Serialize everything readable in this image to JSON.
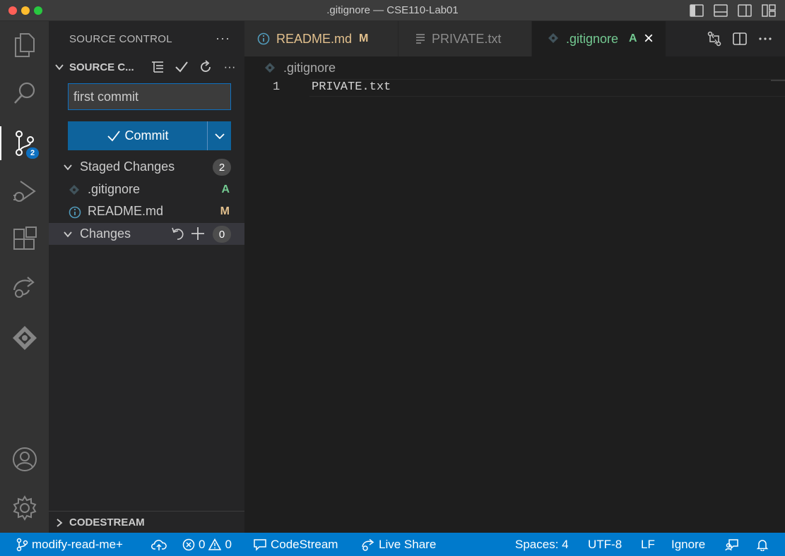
{
  "window": {
    "title": ".gitignore — CSE110-Lab01"
  },
  "activity_bar": {
    "items": [
      "explorer-icon",
      "search-icon",
      "source-control-icon",
      "run-debug-icon",
      "extensions-icon",
      "live-share-icon",
      "codestream-icon",
      "accounts-icon",
      "manage-gear-icon"
    ],
    "source_control_badge": "2"
  },
  "sidebar": {
    "header": "SOURCE CONTROL",
    "more": "···",
    "section_title": "SOURCE C...",
    "section_more": "···",
    "commit_message": "first commit",
    "commit_label": "Commit",
    "staged": {
      "label": "Staged Changes",
      "count": "2",
      "files": [
        {
          "name": ".gitignore",
          "status": "A",
          "status_color": "#73c991"
        },
        {
          "name": "README.md",
          "status": "M",
          "status_color": "#e2c08d"
        }
      ]
    },
    "changes": {
      "label": "Changes",
      "count": "0"
    },
    "codestream_section": "CODESTREAM"
  },
  "tabs": [
    {
      "label": "README.md",
      "status": "M",
      "color": "#e2c08d"
    },
    {
      "label": "PRIVATE.txt",
      "status": "",
      "color": "#8c8c8c"
    },
    {
      "label": ".gitignore",
      "status": "A",
      "color": "#73c991",
      "close": "×"
    }
  ],
  "editor_actions": [
    "open-changes-icon",
    "split-editor-icon",
    "more-actions-icon"
  ],
  "breadcrumb": ".gitignore",
  "editor": {
    "lines": [
      {
        "number": "1",
        "text": "PRIVATE.txt"
      }
    ]
  },
  "status_bar": {
    "branch": "modify-read-me+",
    "errors": "0",
    "warnings": "0",
    "codestream": "CodeStream",
    "live_share": "Live Share",
    "spaces": "Spaces: 4",
    "encoding": "UTF-8",
    "eol": "LF",
    "ignore": "Ignore"
  },
  "colors": {
    "accent": "#007acc",
    "commit_button": "#0e639c",
    "added": "#73c991",
    "modified": "#e2c08d"
  }
}
